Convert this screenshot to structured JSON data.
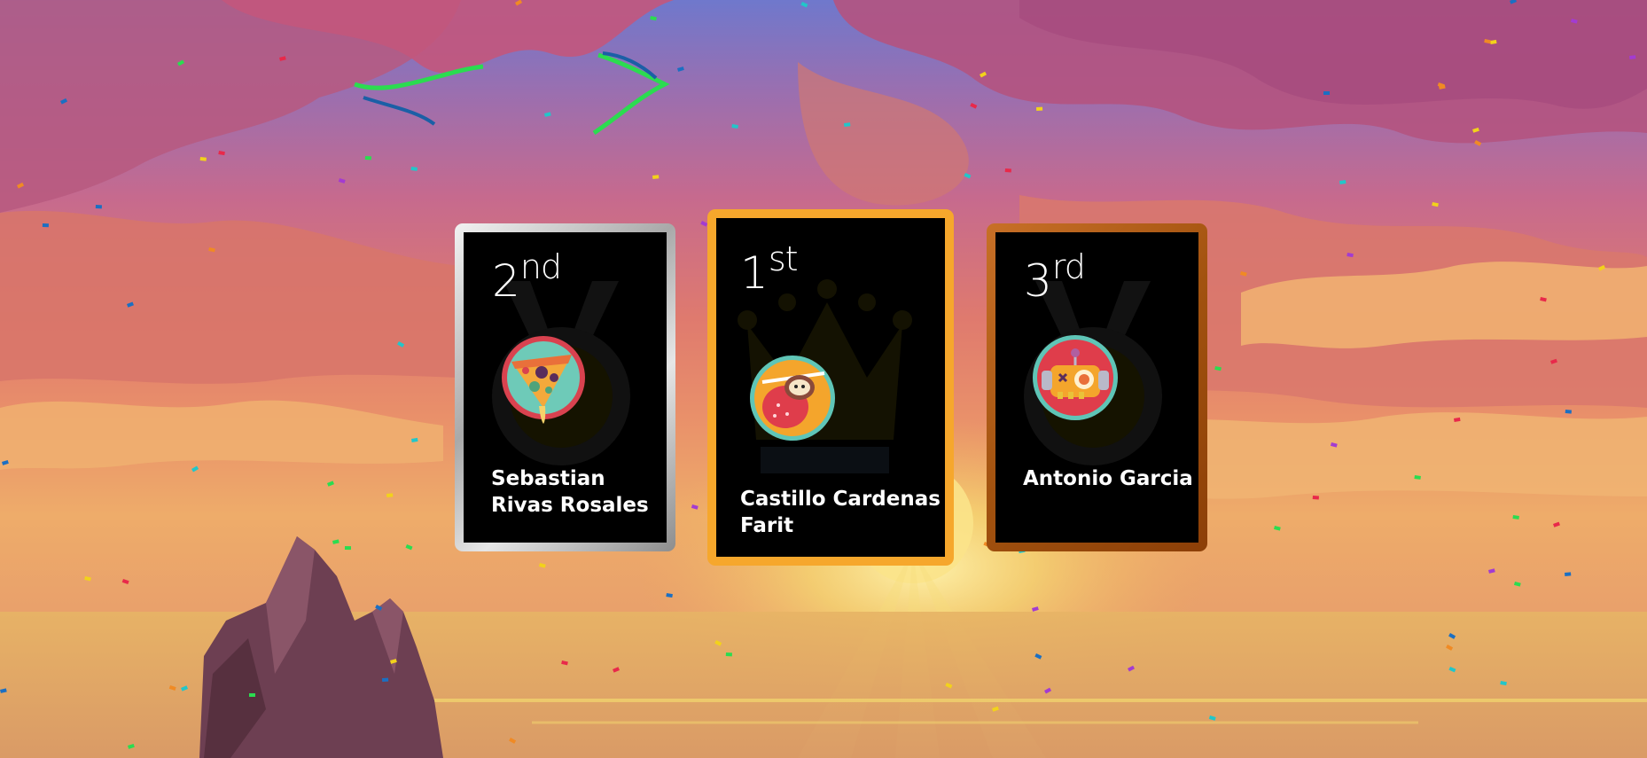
{
  "podium": [
    {
      "place": "second",
      "rank_number": "2",
      "rank_suffix": "nd",
      "name": "Sebastian Rivas Rosales",
      "avatar_icon": "pizza-icon",
      "frame_color": "#c0c0c0"
    },
    {
      "place": "first",
      "rank_number": "1",
      "rank_suffix": "st",
      "name": "Castillo Cardenas Farit",
      "avatar_icon": "sloth-icon",
      "frame_color": "#f6a72c"
    },
    {
      "place": "third",
      "rank_number": "3",
      "rank_suffix": "rd",
      "name": "Antonio Garcia",
      "avatar_icon": "robot-icon",
      "frame_color": "#a2520f"
    }
  ],
  "background": {
    "scene": "sunset-sky-with-confetti"
  },
  "colors": {
    "gold": "#f6a72c",
    "silver": "#c0c0c0",
    "bronze": "#a2520f",
    "card_bg": "#000000"
  }
}
